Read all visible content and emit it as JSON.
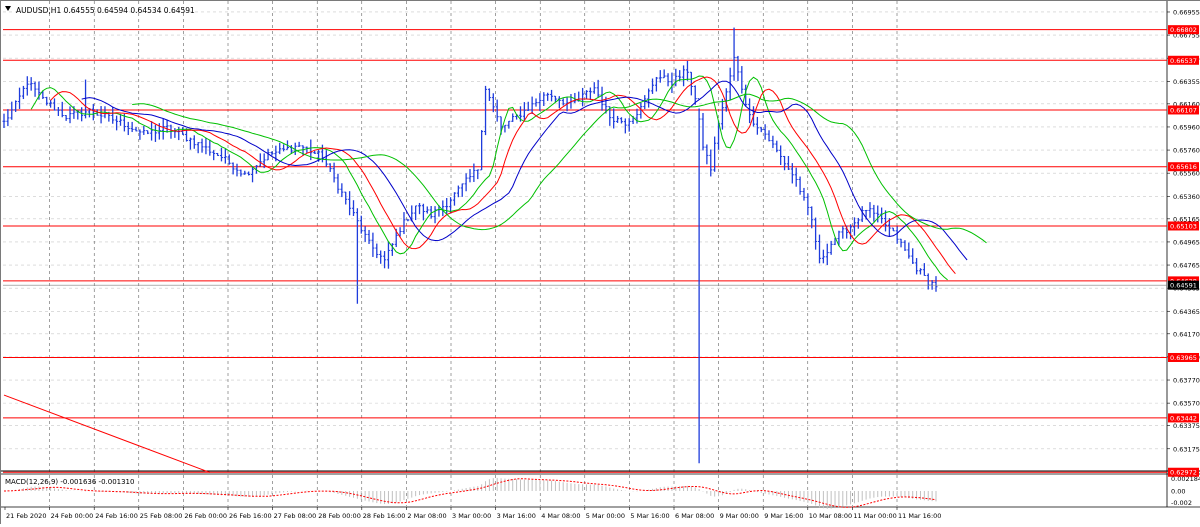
{
  "chart_data": {
    "type": "candlestick",
    "title": "AUDUSD,H1  0.64555 0.64594 0.64534 0.64591",
    "ylim": [
      0.63,
      0.6705
    ],
    "x_labels": [
      "21 Feb 2020",
      "24 Feb 00:00",
      "24 Feb 16:00",
      "25 Feb 08:00",
      "26 Feb 00:00",
      "26 Feb 16:00",
      "27 Feb 08:00",
      "28 Feb 00:00",
      "28 Feb 16:00",
      "2 Mar 08:00",
      "3 Mar 00:00",
      "3 Mar 16:00",
      "4 Mar 08:00",
      "5 Mar 00:00",
      "5 Mar 16:00",
      "6 Mar 08:00",
      "9 Mar 00:00",
      "9 Mar 16:00",
      "10 Mar 08:00",
      "11 Mar 00:00",
      "11 Mar 16:00"
    ],
    "y_ticks": [
      "0.66955",
      "0.66755",
      "0.66555",
      "0.66355",
      "0.66160",
      "0.65960",
      "0.65760",
      "0.65560",
      "0.65360",
      "0.65165",
      "0.64965",
      "0.64765",
      "0.64565",
      "0.64365",
      "0.64170",
      "0.63970",
      "0.63770",
      "0.63570",
      "0.63375",
      "0.63175"
    ],
    "hlines": [
      "0.66802",
      "0.66537",
      "0.66107",
      "0.65616",
      "0.65103",
      "0.64628",
      "0.63965",
      "0.63442",
      "0.62972"
    ],
    "current_price": "0.64591",
    "price_anchors": [
      [
        0,
        0.66
      ],
      [
        3,
        0.6615
      ],
      [
        6,
        0.6635
      ],
      [
        10,
        0.662
      ],
      [
        16,
        0.6605
      ],
      [
        22,
        0.661
      ],
      [
        30,
        0.66
      ],
      [
        36,
        0.659
      ],
      [
        42,
        0.6595
      ],
      [
        48,
        0.6585
      ],
      [
        56,
        0.657
      ],
      [
        62,
        0.6555
      ],
      [
        68,
        0.6572
      ],
      [
        76,
        0.658
      ],
      [
        82,
        0.657
      ],
      [
        86,
        0.6545
      ],
      [
        90,
        0.652
      ],
      [
        94,
        0.6495
      ],
      [
        98,
        0.648
      ],
      [
        102,
        0.6508
      ],
      [
        106,
        0.6528
      ],
      [
        110,
        0.652
      ],
      [
        114,
        0.653
      ],
      [
        118,
        0.6545
      ],
      [
        122,
        0.656
      ],
      [
        124,
        0.663
      ],
      [
        128,
        0.6595
      ],
      [
        134,
        0.661
      ],
      [
        140,
        0.6625
      ],
      [
        146,
        0.6615
      ],
      [
        152,
        0.663
      ],
      [
        156,
        0.6605
      ],
      [
        160,
        0.66
      ],
      [
        164,
        0.6612
      ],
      [
        168,
        0.664
      ],
      [
        172,
        0.6635
      ],
      [
        176,
        0.6645
      ],
      [
        178,
        0.662
      ],
      [
        180,
        0.658
      ],
      [
        182,
        0.656
      ],
      [
        184,
        0.66
      ],
      [
        186,
        0.6625
      ],
      [
        188,
        0.6655
      ],
      [
        190,
        0.663
      ],
      [
        192,
        0.6605
      ],
      [
        196,
        0.659
      ],
      [
        200,
        0.657
      ],
      [
        204,
        0.655
      ],
      [
        208,
        0.6515
      ],
      [
        210,
        0.648
      ],
      [
        214,
        0.65
      ],
      [
        218,
        0.651
      ],
      [
        222,
        0.6525
      ],
      [
        226,
        0.6515
      ],
      [
        230,
        0.65
      ],
      [
        234,
        0.6478
      ],
      [
        238,
        0.6462
      ],
      [
        240,
        0.6459
      ]
    ],
    "spikes": [
      {
        "bar": 21,
        "high": 0.6637
      },
      {
        "bar": 91,
        "low": 0.6443
      },
      {
        "bar": 179,
        "low": 0.6305,
        "high": 0.6612
      },
      {
        "bar": 188,
        "high": 0.6682
      }
    ],
    "trendline": {
      "from": [
        0,
        0.6364
      ],
      "to": [
        53,
        0.6297
      ]
    },
    "ma_periods": [
      5,
      8,
      13,
      21
    ],
    "ma_shifts": [
      3,
      5,
      8,
      13
    ],
    "indicator": {
      "label": "MACD(12,26,9) -0.001636 -0.001310",
      "y_ticks": [
        "0.002184",
        "0.00",
        "-0.002"
      ],
      "ylim": [
        -0.0026,
        0.0026
      ]
    },
    "colors": {
      "grid": "#c8c8c8",
      "hline": "#ff0000",
      "bars": "#1e3cdc",
      "ma": [
        "#00c000",
        "#ff0000",
        "#0000c8"
      ],
      "label_box": "#ff0000",
      "price_box": "#000000",
      "macd_hist": "#c0c0c0",
      "macd_signal": "#ff0000"
    }
  }
}
